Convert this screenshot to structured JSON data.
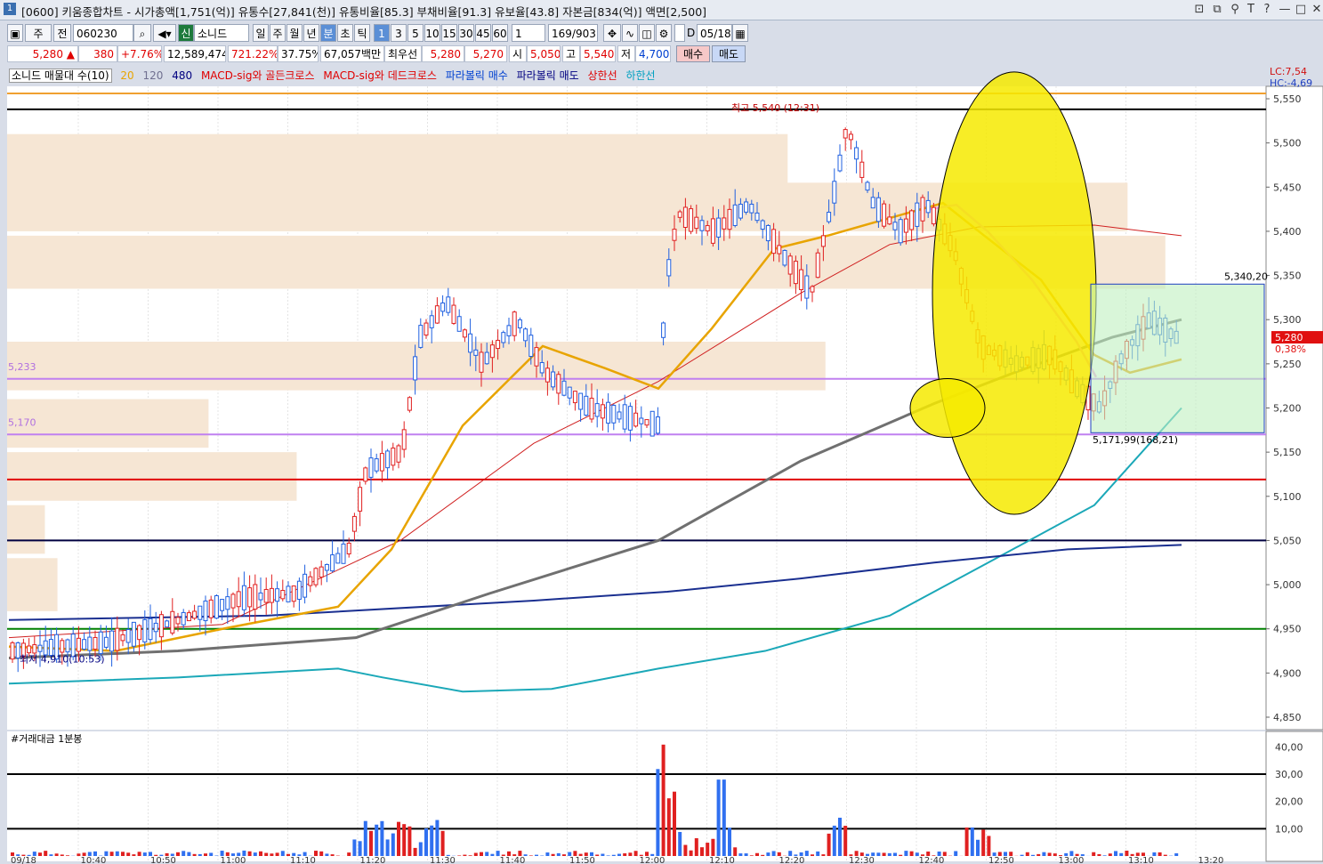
{
  "window": {
    "title": "[0600] 키움종합차트 - 시가총액[1,751(억)] 유통수[27,841(천)] 유통비율[85.3] 부채비율[91.3] 유보율[43.8] 자본금[834(억)] 액면[2,500]",
    "icon_label": "1",
    "buttons": [
      "⊡",
      "⧉",
      "⚲",
      "T",
      "?",
      "—",
      "□",
      "✕"
    ]
  },
  "toolbar": {
    "period_type": "주",
    "scope": "전",
    "code": "060230",
    "search_icon": "magnifier-icon",
    "market_badge": "신",
    "name": "소니드",
    "periods": [
      "일",
      "주",
      "월",
      "년",
      "분",
      "초",
      "틱"
    ],
    "selected_period": "분",
    "intervals": [
      "1",
      "3",
      "5",
      "10",
      "15",
      "30",
      "45",
      "60"
    ],
    "selected_interval": "1",
    "interval_value": "1",
    "count": "169/903",
    "date_checkbox_label": "D",
    "date": "05/18"
  },
  "pricebar": {
    "price": "5,280 ▲",
    "change": "380",
    "change_pct": "+7.76%",
    "volume": "12,589,474",
    "volume_ratio": "721.22%",
    "turnover": "37.75%",
    "amount": "67,057백만",
    "best_bid_label": "최우선",
    "best_ask": "5,280",
    "best_bid": "5,270",
    "open_label": "시",
    "open": "5,050",
    "high_label": "고",
    "high": "5,540",
    "low_label": "저",
    "low": "4,700",
    "buy_button": "매수",
    "sell_button": "매도"
  },
  "legend": {
    "name": "소니드 매물대 수(10)",
    "ma20": "20",
    "ma120": "120",
    "ma480": "480",
    "s1": "MACD-sig와 골든크로스",
    "s2": "MACD-sig와 데드크로스",
    "s3": "파라볼릭 매수",
    "s4": "파라볼릭 매도",
    "s5": "상한선",
    "s6": "하한선",
    "colors": {
      "ma20": "#e8a400",
      "ma120": "#7070a0",
      "ma480": "#000080",
      "golden": "#e00000",
      "dead": "#e00000",
      "para_buy": "#0040d0",
      "para_sell": "#000080",
      "upper": "#e00000",
      "lower": "#00a0c0"
    }
  },
  "chart_data": {
    "type": "candlestick",
    "y_axis": {
      "min": 4850,
      "max": 5550,
      "ticks": [
        "5,550",
        "5,500",
        "5,450",
        "5,400",
        "5,350",
        "5,300",
        "5,250",
        "5,200",
        "5,150",
        "5,100",
        "5,050",
        "5,000",
        "4,950",
        "4,900",
        "4,850"
      ]
    },
    "current_price_label": "5,280",
    "current_pct_label": "0,38%",
    "lc_label": "LC:7,54",
    "hc_label": "HC:-4,69",
    "annotations": {
      "high": "최고 5,540 (12:31)",
      "low": "최저 4,910(10:53)",
      "box_top": "5,340,20",
      "box_bottom": "5,171,99(168,21)",
      "level_a": "5,233",
      "level_b": "5,170"
    },
    "horizontal_levels": [
      {
        "value": 5556,
        "color": "#f0a030"
      },
      {
        "value": 5538,
        "color": "#000000"
      },
      {
        "value": 5233,
        "color": "#c080f0"
      },
      {
        "value": 5170,
        "color": "#c080f0"
      },
      {
        "value": 5119,
        "color": "#e00000"
      },
      {
        "value": 5050,
        "color": "#000040"
      },
      {
        "value": 4950,
        "color": "#008000"
      }
    ],
    "volume_profile": [
      {
        "low": 5450,
        "high": 5510,
        "strength": 0.62
      },
      {
        "low": 5400,
        "high": 5455,
        "strength": 0.89
      },
      {
        "low": 5335,
        "high": 5395,
        "strength": 0.92
      },
      {
        "low": 5220,
        "high": 5275,
        "strength": 0.65
      },
      {
        "low": 5155,
        "high": 5210,
        "strength": 0.16
      },
      {
        "low": 5095,
        "high": 5150,
        "strength": 0.23
      },
      {
        "low": 5035,
        "high": 5090,
        "strength": 0.03
      },
      {
        "low": 4970,
        "high": 5030,
        "strength": 0.04
      }
    ],
    "volume_panel": {
      "title": "#거래대금 1분봉",
      "y_ticks": [
        "40,00",
        "30,00",
        "20,00",
        "10,00"
      ],
      "levels": [
        30,
        10
      ]
    },
    "x_labels": [
      "09/18",
      "10:40",
      "10:50",
      "11:00",
      "11:10",
      "11:20",
      "11:30",
      "11:40",
      "11:50",
      "12:00",
      "12:10",
      "12:20",
      "12:30",
      "12:40",
      "12:50",
      "13:00",
      "13:10",
      "13:20"
    ]
  }
}
